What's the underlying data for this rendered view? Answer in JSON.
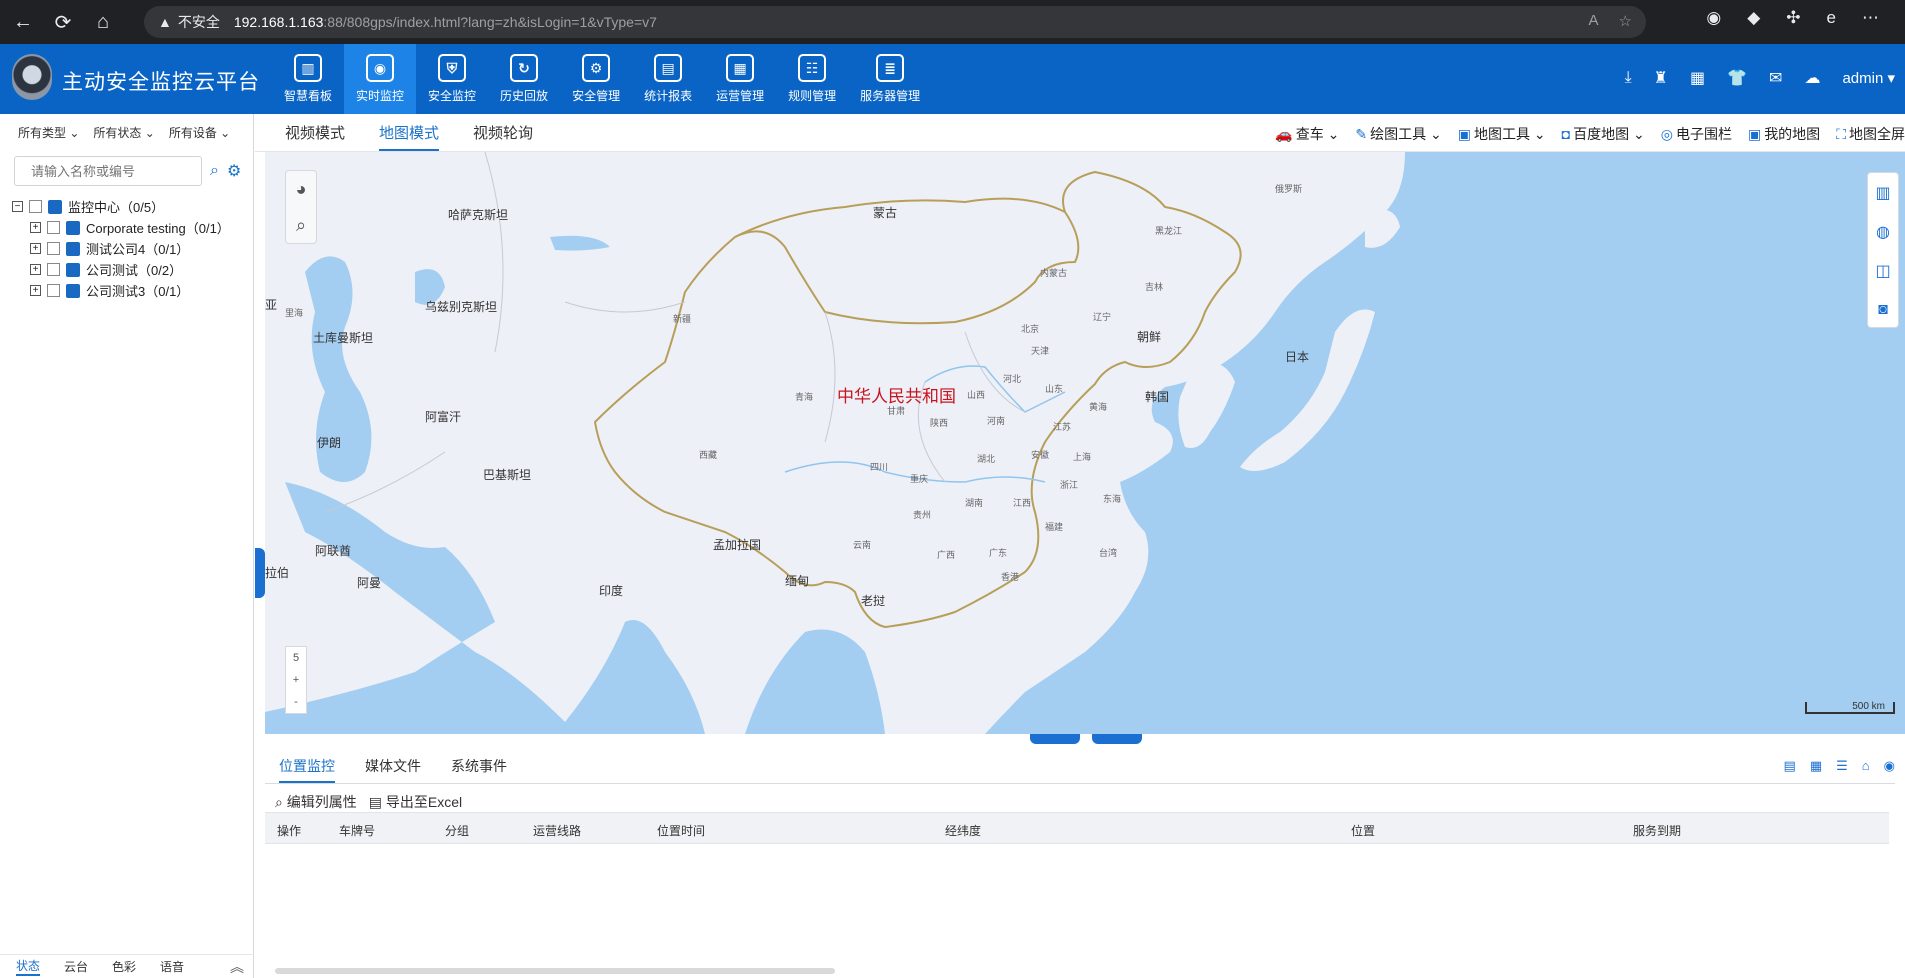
{
  "browser": {
    "insecure_label": "不安全",
    "url_host": "192.168.1.163",
    "url_path": ":88/808gps/index.html?lang=zh&isLogin=1&vType=v7"
  },
  "app": {
    "title": "主动安全监控云平台",
    "user": "admin",
    "accent_color": "#0a64c6"
  },
  "menu": [
    {
      "label": "智慧看板",
      "icon": "chart-board-icon"
    },
    {
      "label": "实时监控",
      "icon": "map-pin-icon",
      "active": true
    },
    {
      "label": "安全监控",
      "icon": "shield-icon"
    },
    {
      "label": "历史回放",
      "icon": "playback-icon"
    },
    {
      "label": "安全管理",
      "icon": "shield-gear-icon"
    },
    {
      "label": "统计报表",
      "icon": "report-icon"
    },
    {
      "label": "运营管理",
      "icon": "operation-icon"
    },
    {
      "label": "规则管理",
      "icon": "rules-icon"
    },
    {
      "label": "服务器管理",
      "icon": "server-icon"
    }
  ],
  "left": {
    "filters": [
      "所有类型",
      "所有状态",
      "所有设备"
    ],
    "search_placeholder": "请输入名称或编号",
    "tree_root": "监控中心（0/5）",
    "tree_children": [
      "Corporate testing（0/1）",
      "测试公司4（0/1）",
      "公司测试（0/2）",
      "公司测试3（0/1）"
    ],
    "bottom_tabs": [
      "状态",
      "云台",
      "色彩",
      "语音"
    ]
  },
  "mode_tabs": [
    "视频模式",
    "地图模式",
    "视频轮询"
  ],
  "map_tools": [
    "查车",
    "绘图工具",
    "地图工具",
    "百度地图",
    "电子围栏",
    "我的地图",
    "地图全屏"
  ],
  "map": {
    "zoom_level": "5",
    "zoom_in": "+",
    "zoom_out": "-",
    "scale_label": "500 km",
    "labels": {
      "china": "中华人民共和国",
      "mongolia": "蒙古",
      "kazakhstan": "哈萨克斯坦",
      "uzbekistan": "乌兹别克斯坦",
      "turkmenistan": "土库曼斯坦",
      "afghanistan": "阿富汗",
      "iran": "伊朗",
      "pakistan": "巴基斯坦",
      "india": "印度",
      "bangladesh": "孟加拉国",
      "myanmar": "缅甸",
      "laos": "老挝",
      "oman": "阿曼",
      "uae": "阿联酋",
      "korea_north": "朝鲜",
      "korea_south": "韩国",
      "japan": "日本",
      "caspian": "里海",
      "xinjiang": "新疆",
      "xizang": "西藏",
      "qinghai": "青海",
      "gansu": "甘肃",
      "sichuan": "四川",
      "yunnan": "云南",
      "neimenggu": "内蒙古",
      "heilongjiang": "黑龙江",
      "jilin": "吉林",
      "liaoning": "辽宁",
      "beijing": "北京",
      "tianjin": "天津",
      "hebei": "河北",
      "shanxi": "山西",
      "shaanxi": "陕西",
      "henan": "河南",
      "shandong": "山东",
      "jiangsu": "江苏",
      "anhui": "安徽",
      "hubei": "湖北",
      "shanghai": "上海",
      "zhejiang": "浙江",
      "hunan": "湖南",
      "jiangxi": "江西",
      "fujian": "福建",
      "guizhou": "贵州",
      "guangxi": "广西",
      "guangdong": "广东",
      "chongqing": "重庆",
      "taiwan": "台湾",
      "hongkong": "香港",
      "yellow_sea": "黄海",
      "east_sea": "东海",
      "russia_fareast": "俄罗斯",
      "ya": "亚",
      "la": "拉伯"
    }
  },
  "bottom": {
    "tabs": [
      "位置监控",
      "媒体文件",
      "系统事件"
    ],
    "actions": [
      "编辑列属性",
      "导出至Excel"
    ],
    "columns": [
      "操作",
      "车牌号",
      "分组",
      "运营线路",
      "位置时间",
      "经纬度",
      "位置",
      "服务到期"
    ]
  }
}
